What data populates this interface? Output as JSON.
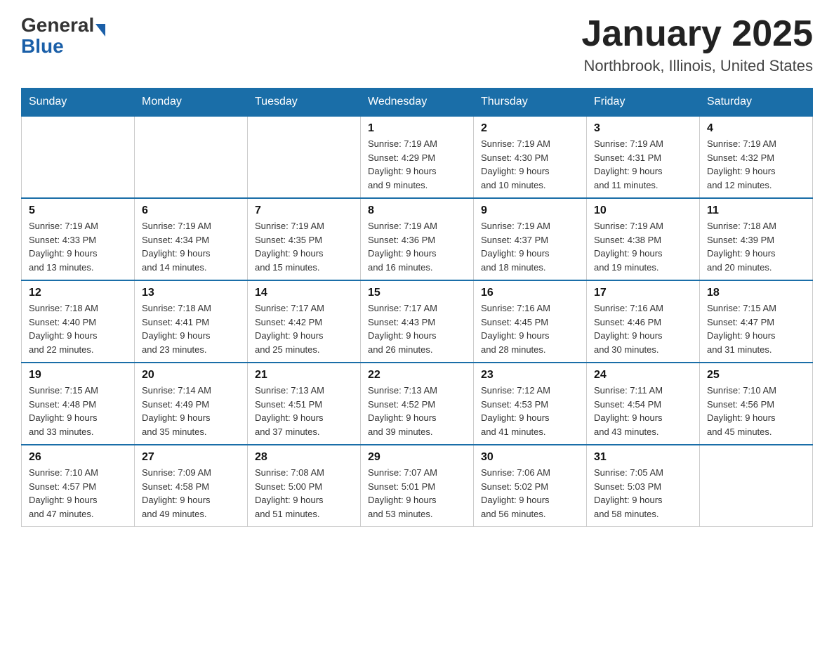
{
  "logo": {
    "general": "General",
    "blue": "Blue",
    "arrow_color": "#1a5fa8"
  },
  "header": {
    "month_year": "January 2025",
    "location": "Northbrook, Illinois, United States"
  },
  "weekdays": [
    "Sunday",
    "Monday",
    "Tuesday",
    "Wednesday",
    "Thursday",
    "Friday",
    "Saturday"
  ],
  "weeks": [
    [
      {
        "day": "",
        "info": ""
      },
      {
        "day": "",
        "info": ""
      },
      {
        "day": "",
        "info": ""
      },
      {
        "day": "1",
        "info": "Sunrise: 7:19 AM\nSunset: 4:29 PM\nDaylight: 9 hours\nand 9 minutes."
      },
      {
        "day": "2",
        "info": "Sunrise: 7:19 AM\nSunset: 4:30 PM\nDaylight: 9 hours\nand 10 minutes."
      },
      {
        "day": "3",
        "info": "Sunrise: 7:19 AM\nSunset: 4:31 PM\nDaylight: 9 hours\nand 11 minutes."
      },
      {
        "day": "4",
        "info": "Sunrise: 7:19 AM\nSunset: 4:32 PM\nDaylight: 9 hours\nand 12 minutes."
      }
    ],
    [
      {
        "day": "5",
        "info": "Sunrise: 7:19 AM\nSunset: 4:33 PM\nDaylight: 9 hours\nand 13 minutes."
      },
      {
        "day": "6",
        "info": "Sunrise: 7:19 AM\nSunset: 4:34 PM\nDaylight: 9 hours\nand 14 minutes."
      },
      {
        "day": "7",
        "info": "Sunrise: 7:19 AM\nSunset: 4:35 PM\nDaylight: 9 hours\nand 15 minutes."
      },
      {
        "day": "8",
        "info": "Sunrise: 7:19 AM\nSunset: 4:36 PM\nDaylight: 9 hours\nand 16 minutes."
      },
      {
        "day": "9",
        "info": "Sunrise: 7:19 AM\nSunset: 4:37 PM\nDaylight: 9 hours\nand 18 minutes."
      },
      {
        "day": "10",
        "info": "Sunrise: 7:19 AM\nSunset: 4:38 PM\nDaylight: 9 hours\nand 19 minutes."
      },
      {
        "day": "11",
        "info": "Sunrise: 7:18 AM\nSunset: 4:39 PM\nDaylight: 9 hours\nand 20 minutes."
      }
    ],
    [
      {
        "day": "12",
        "info": "Sunrise: 7:18 AM\nSunset: 4:40 PM\nDaylight: 9 hours\nand 22 minutes."
      },
      {
        "day": "13",
        "info": "Sunrise: 7:18 AM\nSunset: 4:41 PM\nDaylight: 9 hours\nand 23 minutes."
      },
      {
        "day": "14",
        "info": "Sunrise: 7:17 AM\nSunset: 4:42 PM\nDaylight: 9 hours\nand 25 minutes."
      },
      {
        "day": "15",
        "info": "Sunrise: 7:17 AM\nSunset: 4:43 PM\nDaylight: 9 hours\nand 26 minutes."
      },
      {
        "day": "16",
        "info": "Sunrise: 7:16 AM\nSunset: 4:45 PM\nDaylight: 9 hours\nand 28 minutes."
      },
      {
        "day": "17",
        "info": "Sunrise: 7:16 AM\nSunset: 4:46 PM\nDaylight: 9 hours\nand 30 minutes."
      },
      {
        "day": "18",
        "info": "Sunrise: 7:15 AM\nSunset: 4:47 PM\nDaylight: 9 hours\nand 31 minutes."
      }
    ],
    [
      {
        "day": "19",
        "info": "Sunrise: 7:15 AM\nSunset: 4:48 PM\nDaylight: 9 hours\nand 33 minutes."
      },
      {
        "day": "20",
        "info": "Sunrise: 7:14 AM\nSunset: 4:49 PM\nDaylight: 9 hours\nand 35 minutes."
      },
      {
        "day": "21",
        "info": "Sunrise: 7:13 AM\nSunset: 4:51 PM\nDaylight: 9 hours\nand 37 minutes."
      },
      {
        "day": "22",
        "info": "Sunrise: 7:13 AM\nSunset: 4:52 PM\nDaylight: 9 hours\nand 39 minutes."
      },
      {
        "day": "23",
        "info": "Sunrise: 7:12 AM\nSunset: 4:53 PM\nDaylight: 9 hours\nand 41 minutes."
      },
      {
        "day": "24",
        "info": "Sunrise: 7:11 AM\nSunset: 4:54 PM\nDaylight: 9 hours\nand 43 minutes."
      },
      {
        "day": "25",
        "info": "Sunrise: 7:10 AM\nSunset: 4:56 PM\nDaylight: 9 hours\nand 45 minutes."
      }
    ],
    [
      {
        "day": "26",
        "info": "Sunrise: 7:10 AM\nSunset: 4:57 PM\nDaylight: 9 hours\nand 47 minutes."
      },
      {
        "day": "27",
        "info": "Sunrise: 7:09 AM\nSunset: 4:58 PM\nDaylight: 9 hours\nand 49 minutes."
      },
      {
        "day": "28",
        "info": "Sunrise: 7:08 AM\nSunset: 5:00 PM\nDaylight: 9 hours\nand 51 minutes."
      },
      {
        "day": "29",
        "info": "Sunrise: 7:07 AM\nSunset: 5:01 PM\nDaylight: 9 hours\nand 53 minutes."
      },
      {
        "day": "30",
        "info": "Sunrise: 7:06 AM\nSunset: 5:02 PM\nDaylight: 9 hours\nand 56 minutes."
      },
      {
        "day": "31",
        "info": "Sunrise: 7:05 AM\nSunset: 5:03 PM\nDaylight: 9 hours\nand 58 minutes."
      },
      {
        "day": "",
        "info": ""
      }
    ]
  ]
}
